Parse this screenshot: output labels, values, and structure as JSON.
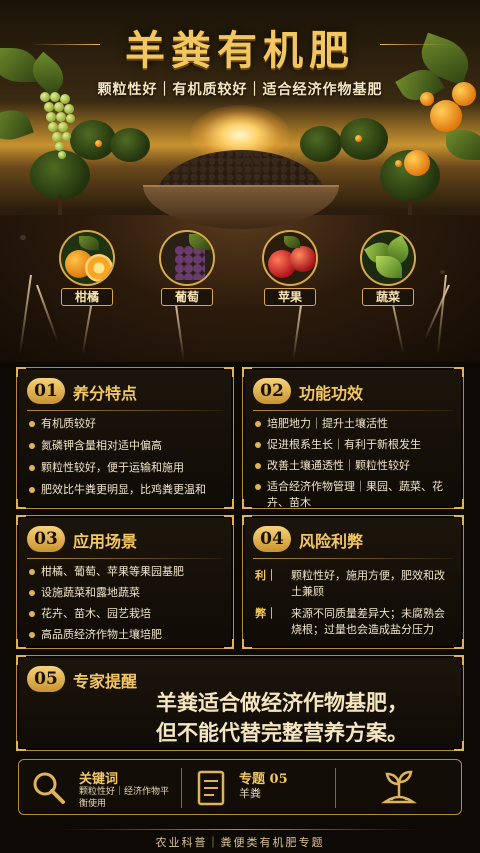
{
  "header": {
    "title": "羊粪有机肥",
    "subtitle": "颗粒性好｜有机质较好｜适合经济作物基肥"
  },
  "crops": [
    {
      "label": "柑橘",
      "icon": "citrus-icon"
    },
    {
      "label": "葡萄",
      "icon": "grape-icon"
    },
    {
      "label": "苹果",
      "icon": "apple-icon"
    },
    {
      "label": "蔬菜",
      "icon": "vegetable-icon"
    }
  ],
  "sections": {
    "nutrients": {
      "num": "01",
      "title": "养分特点",
      "items": [
        "有机质较好",
        "氮磷钾含量相对适中偏高",
        "颗粒性较好，便于运输和施用",
        "肥效比牛粪更明显，比鸡粪更温和"
      ]
    },
    "functions": {
      "num": "02",
      "title": "功能功效",
      "items": [
        "培肥地力｜提升土壤活性",
        "促进根系生长｜有利于新根发生",
        "改善土壤通透性｜颗粒性较好",
        "适合经济作物管理｜果园、蔬菜、花卉、苗木"
      ]
    },
    "scenarios": {
      "num": "03",
      "title": "应用场景",
      "items": [
        "柑橘、葡萄、苹果等果园基肥",
        "设施蔬菜和露地蔬菜",
        "花卉、苗木、园艺栽培",
        "高品质经济作物土壤培肥"
      ]
    },
    "risks": {
      "num": "04",
      "title": "风险利弊",
      "pro_key": "利｜",
      "pro": "颗粒性好，施用方便，肥效和改土兼顾",
      "con_key": "弊｜",
      "con": "来源不同质量差异大；未腐熟会烧根；过量也会造成盐分压力"
    },
    "advice": {
      "num": "05",
      "title": "专家提醒",
      "line1": "羊粪适合做经济作物基肥，",
      "line2": "但不能代替完整营养方案。"
    }
  },
  "bottom": {
    "keywords_title": "关键词",
    "keywords_text": "颗粒性好｜经济作物平衡使用",
    "topic_title": "专题 05",
    "topic_text": "羊粪"
  },
  "footer": "农业科普｜粪便类有机肥专题",
  "colors": {
    "accent": "#f2c660",
    "border": "#b8893b",
    "background": "#0d0a06"
  }
}
